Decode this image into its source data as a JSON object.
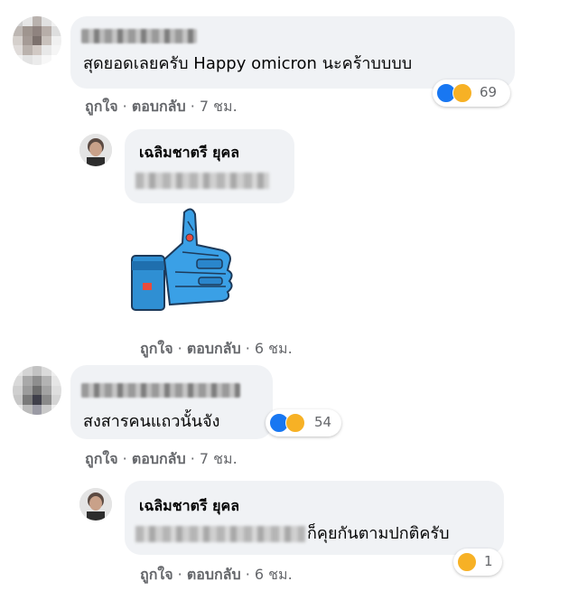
{
  "colors": {
    "bubble_bg": "#f0f2f5",
    "meta_text": "#65676b",
    "like_blue": "#1877f2",
    "haha_yellow": "#f7b125"
  },
  "comment1": {
    "text": "สุดยอดเลยครับ Happy omicron นะคร้าบบบบ",
    "actions": {
      "like": "ถูกใจ",
      "reply": "ตอบกลับ",
      "time": "7 ชม."
    },
    "reactions": {
      "icons": [
        "like-icon",
        "haha-icon"
      ],
      "count": "69"
    }
  },
  "reply1": {
    "author": "เฉลิมชาตรี ยุคล",
    "sticker": "robot-thumbs-up-sticker",
    "actions": {
      "like": "ถูกใจ",
      "reply": "ตอบกลับ",
      "time": "6 ชม."
    }
  },
  "comment2": {
    "text": "สงสารคนแถวนั้นจัง",
    "actions": {
      "like": "ถูกใจ",
      "reply": "ตอบกลับ",
      "time": "7 ชม."
    },
    "reactions": {
      "icons": [
        "like-icon",
        "haha-icon"
      ],
      "count": "54"
    }
  },
  "reply2": {
    "author": "เฉลิมชาตรี ยุคล",
    "text": "ก็คุยกันตามปกติครับ",
    "actions": {
      "like": "ถูกใจ",
      "reply": "ตอบกลับ",
      "time": "6 ชม."
    },
    "reactions": {
      "icons": [
        "haha-icon"
      ],
      "count": "1"
    }
  }
}
